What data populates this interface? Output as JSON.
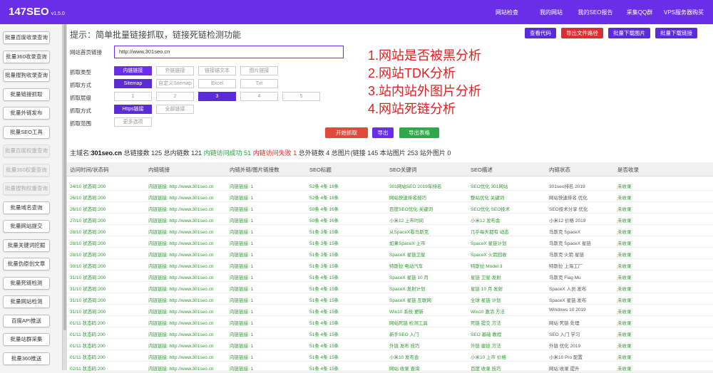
{
  "app": {
    "title": "147SEO",
    "version": "v1.5.0"
  },
  "topnav": [
    "网站检查",
    "我的网站",
    "我的SEO报告",
    "采集QQ群",
    "VPS服务器购买"
  ],
  "sidebar": [
    {
      "label": "批量百度收录查询",
      "disabled": false
    },
    {
      "label": "批量360收录查询",
      "disabled": false
    },
    {
      "label": "批量搜狗收录查询",
      "disabled": false
    },
    {
      "label": "批量链接抓取",
      "disabled": false
    },
    {
      "label": "批量外链发布",
      "disabled": false
    },
    {
      "label": "批量SEO工具",
      "disabled": false
    },
    {
      "label": "批量百度权重查询",
      "disabled": true
    },
    {
      "label": "批量360权重查询",
      "disabled": true
    },
    {
      "label": "批量搜狗权重查询",
      "disabled": true
    },
    {
      "label": "批量域名查询",
      "disabled": false
    },
    {
      "label": "批量网站提交",
      "disabled": false
    },
    {
      "label": "批量关键词挖掘",
      "disabled": false
    },
    {
      "label": "批量伪原创文章",
      "disabled": false
    },
    {
      "label": "批量死链检测",
      "disabled": false
    },
    {
      "label": "批量网站检测",
      "disabled": false
    },
    {
      "label": "百度API推送",
      "disabled": false
    },
    {
      "label": "批量站群采集",
      "disabled": false
    },
    {
      "label": "批量360推送",
      "disabled": false
    }
  ],
  "tip": "提示：简单批量链接抓取，链接死链检测功能",
  "right_buttons": [
    {
      "label": "查看代码",
      "color": "purple"
    },
    {
      "label": "导出文件路径",
      "color": "red"
    },
    {
      "label": "批量下载图片",
      "color": "purple"
    },
    {
      "label": "批量下载链接",
      "color": "purple"
    }
  ],
  "form": {
    "url_label": "网站首页链接",
    "url_value": "http://www.301seo.cn",
    "row_labels": [
      "抓取类型",
      "抓取方式",
      "抓取层级",
      "抓取方式",
      "抓取范围"
    ],
    "type_options": [
      {
        "label": "内链链接",
        "state": "on"
      },
      {
        "label": "外链链接",
        "state": "off"
      },
      {
        "label": "链接锚文本",
        "state": "off"
      },
      {
        "label": "图片链接",
        "state": "off"
      }
    ],
    "method_options": [
      {
        "label": "Sitemap",
        "state": "dark"
      },
      {
        "label": "自定义Sitemap",
        "state": "off"
      },
      {
        "label": "Excel",
        "state": "off"
      },
      {
        "label": "Txt",
        "state": "off"
      }
    ],
    "depth_options": [
      {
        "label": "1",
        "state": "off"
      },
      {
        "label": "2",
        "state": "off"
      },
      {
        "label": "3",
        "state": "dark"
      },
      {
        "label": "4",
        "state": "off"
      },
      {
        "label": "5",
        "state": "off"
      }
    ],
    "mode_options": [
      {
        "label": "Https链接",
        "state": "dark"
      },
      {
        "label": "全部链接",
        "state": "off"
      }
    ],
    "scope_options": [
      {
        "label": "更多选项",
        "state": "off"
      }
    ]
  },
  "features": [
    "1.网站是否被黑分析",
    "2.网站TDK分析",
    "3.站内站外图片分析",
    "4.网站死链分析"
  ],
  "actions": [
    {
      "label": "开始抓取",
      "color": "#e04a3a"
    },
    {
      "label": "导出",
      "color": "#6a2ee8"
    },
    {
      "label": "导出表格",
      "color": "#2ea84a"
    }
  ],
  "stats": {
    "domain_label": "主域名:",
    "domain": "301seo.cn",
    "total": "总链接数 125",
    "internal": "总内链数 121",
    "success": "内链访问成功 51",
    "fail": "内链访问失败 1",
    "external": "总外链数 4",
    "images": "总图片(链接 145",
    "local_img": "本站图片 253",
    "ext_img": "站外图片 0"
  },
  "table": {
    "headers": [
      "访问时间/状态码",
      "内链链接",
      "内链外链/图片链接数",
      "SEO标题",
      "SEO关键词",
      "SEO描述",
      "内链状态",
      "是否收录"
    ],
    "rows": [
      [
        "24/10 状态码:200",
        "内链链接: http://www.301seo.cn",
        "内链链接: 1",
        "52条 4条 18条",
        "301网站SEO 2019年排名",
        "SEO优化 301网站",
        "301seo排名 2019",
        "未收录"
      ],
      [
        "26/10 状态码:200",
        "内链链接: http://www.301seo.cn",
        "内链链接: 1",
        "52条 4条 18条",
        "网站快速排名技巧",
        "整站优化 关键词",
        "网站快速排名 优化",
        "未收录"
      ],
      [
        "26/10 状态码:200",
        "内链链接: http://www.301seo.cn",
        "内链链接: 1",
        "50条 4条 16条",
        "百度SEO优化 关键词",
        "SEO优化 SEO技术",
        "SEO技术分享 优化",
        "未收录"
      ],
      [
        "27/10 状态码:200",
        "内链链接: http://www.301seo.cn",
        "内链链接: 1",
        "50条 4条 16条",
        "小米12 上市时间",
        "小米12 发布会",
        "小米12 价格 2019",
        "未收录"
      ],
      [
        "28/10 状态码:200",
        "内链链接: http://www.301seo.cn",
        "内链链接: 1",
        "51条 3条 15条",
        "从SpaceX看马斯克",
        "几乎每天都有 动态",
        "马斯克 SpaceX",
        "未收录"
      ],
      [
        "28/10 状态码:200",
        "内链链接: http://www.301seo.cn",
        "内链链接: 1",
        "51条 3条 15条",
        "如果SpaceX 上市",
        "SpaceX 星链计划",
        "马斯克 SpaceX 星链",
        "未收录"
      ],
      [
        "28/10 状态码:200",
        "内链链接: http://www.301seo.cn",
        "内链链接: 1",
        "51条 3条 15条",
        "SpaceX 星链卫星",
        "SpaceX 火箭回收",
        "马斯克 火箭 星链",
        "未收录"
      ],
      [
        "30/10 状态码:200",
        "内链链接: http://www.301seo.cn",
        "内链链接: 1",
        "51条 3条 15条",
        "特斯拉 电动汽车",
        "特斯拉 Model 3",
        "特斯拉 上海工厂",
        "未收录"
      ],
      [
        "31/10 状态码:200",
        "内链链接: http://www.301seo.cn",
        "内链链接: 1",
        "51条 4条 15条",
        "SpaceX 星链 10 月",
        "星链 卫星 发射",
        "马斯克 Flag Mu",
        "未收录"
      ],
      [
        "31/10 状态码:200",
        "内链链接: http://www.301seo.cn",
        "内链链接: 1",
        "51条 4条 15条",
        "SpaceX 发射计划",
        "星链 10 月 发射",
        "SpaceX 人员 发布",
        "未收录"
      ],
      [
        "31/10 状态码:200",
        "内链链接: http://www.301seo.cn",
        "内链链接: 1",
        "51条 4条 15条",
        "SpaceX 星链 互联网",
        "全球 星链 计划",
        "SpaceX 星链 发布",
        "未收录"
      ],
      [
        "31/10 状态码:200",
        "内链链接: http://www.301seo.cn",
        "内链链接: 1",
        "51条 4条 15条",
        "Win10 系统 更新",
        "Win10 激活 方法",
        "Windows 10 2019",
        "未收录"
      ],
      [
        "01/11 状态码:200",
        "内链链接: http://www.301seo.cn",
        "内链链接: 1",
        "51条 4条 15条",
        "网站死链 检测工具",
        "死链 提交 方法",
        "网站 死链 处理",
        "未收录"
      ],
      [
        "01/11 状态码:200",
        "内链链接: http://www.301seo.cn",
        "内链链接: 1",
        "51条 4条 15条",
        "新手SEO 入门",
        "SEO 基础 教程",
        "SEO 入门 学习",
        "未收录"
      ],
      [
        "01/11 状态码:200",
        "内链链接: http://www.301seo.cn",
        "内链链接: 1",
        "51条 4条 15条",
        "外链 发布 技巧",
        "外链 建设 方法",
        "外链 优化 2019",
        "未收录"
      ],
      [
        "01/11 状态码:200",
        "内链链接: http://www.301seo.cn",
        "内链链接: 1",
        "51条 4条 15条",
        "小米10 发布会",
        "小米10 上市 价格",
        "小米10 Pro 配置",
        "未收录"
      ],
      [
        "02/11 状态码:200",
        "内链链接: http://www.301seo.cn",
        "内链链接: 1",
        "51条 4条 15条",
        "网站 收录 查询",
        "百度 收录 技巧",
        "网站 收录 提升",
        "未收录"
      ]
    ]
  }
}
